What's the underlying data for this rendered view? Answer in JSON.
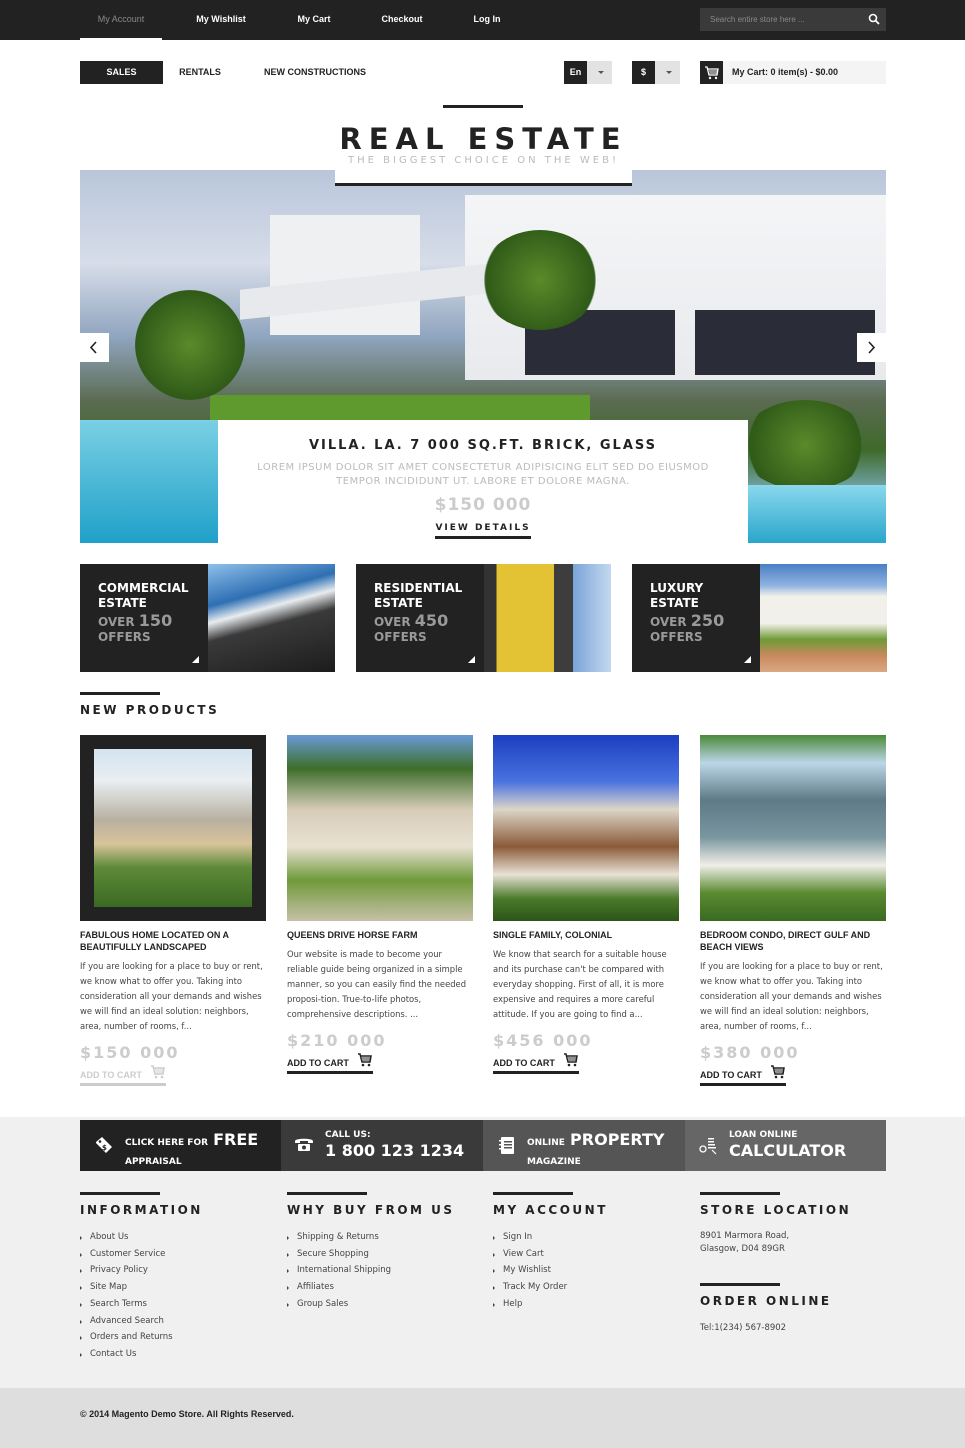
{
  "topbar": {
    "links": [
      "My Account",
      "My Wishlist",
      "My Cart",
      "Checkout",
      "Log In"
    ],
    "active_link": "My Account",
    "search_placeholder": "Search entire store here ..."
  },
  "category_nav": [
    "SALES",
    "RENTALS",
    "NEW CONSTRUCTIONS"
  ],
  "language": {
    "value": "En"
  },
  "currency": {
    "value": "$"
  },
  "cart": {
    "label": "My Cart: 0 item(s) - $0.00"
  },
  "logo": {
    "title": "REAL ESTATE",
    "slogan": "THE BIGGEST CHOICE ON THE WEB!"
  },
  "hero": {
    "title": "VILLA. LA. 7 000 SQ.FT. BRICK, GLASS",
    "description": "LOREM IPSUM DOLOR SIT AMET CONSECTETUR ADIPISICING ELIT SED DO EIUSMOD TEMPOR INCIDIDUNT UT. LABORE ET DOLORE MAGNA.",
    "price": "$150 000",
    "button": "VIEW DETAILS"
  },
  "banners": [
    {
      "line1": "COMMERCIAL",
      "line2": "ESTATE",
      "over": "OVER",
      "count": "150",
      "offers": "OFFERS"
    },
    {
      "line1": "RESIDENTIAL",
      "line2": "ESTATE",
      "over": "OVER",
      "count": "450",
      "offers": "OFFERS"
    },
    {
      "line1": "LUXURY",
      "line2": "ESTATE",
      "over": "OVER",
      "count": "250",
      "offers": "OFFERS"
    }
  ],
  "new_products": {
    "title": "NEW PRODUCTS",
    "items": [
      {
        "name": "FABULOUS HOME LOCATED ON A BEAUTIFULLY LANDSCAPED",
        "description": "If you are looking for a place to buy or rent, we know what to offer you. Taking into consideration all your demands and wishes we will find an ideal solution: neighbors, area, number of rooms, f...",
        "price": "$150 000",
        "add_to_cart": "ADD TO CART"
      },
      {
        "name": "QUEENS DRIVE HORSE FARM",
        "description": "Our website is made to become your reliable guide being organized in a simple manner, so you can easily find the needed proposi-tion. True-to-life photos, comprehensive descriptions. ...",
        "price": "$210 000",
        "add_to_cart": "ADD TO CART"
      },
      {
        "name": "SINGLE FAMILY, COLONIAL",
        "description": "We know that search for a suitable house and its purchase can't be compared with everyday shopping. First of all, it is more expensive and requires a more careful attitude. If you are going to find a...",
        "price": "$456 000",
        "add_to_cart": "ADD TO CART"
      },
      {
        "name": "BEDROOM CONDO, DIRECT GULF AND BEACH VIEWS",
        "description": "If you are looking for a place to buy or rent, we know what to offer you. Taking into consideration all your demands and wishes we will find an ideal solution: neighbors, area, number of rooms, f...",
        "price": "$380 000",
        "add_to_cart": "ADD TO CART"
      }
    ]
  },
  "promo": [
    {
      "small1": "CLICK HERE FOR",
      "big": "FREE",
      "small2": "APPRAISAL",
      "icon": "price-tag-icon",
      "color": "#222222"
    },
    {
      "small1": "CALL US:",
      "big": "1 800 123 1234",
      "icon": "phone-icon",
      "color": "#3a3a3a"
    },
    {
      "small1": "ONLINE",
      "big": "PROPERTY",
      "small2": "MAGAZINE",
      "icon": "notebook-icon",
      "color": "#555555"
    },
    {
      "small1": "LOAN ONLINE",
      "big": "CALCULATOR",
      "icon": "coins-icon",
      "color": "#666666"
    }
  ],
  "footer": {
    "information": {
      "title": "INFORMATION",
      "links": [
        "About Us",
        "Customer Service",
        "Privacy Policy",
        "Site Map",
        "Search Terms",
        "Advanced Search",
        "Orders and Returns",
        "Contact Us"
      ]
    },
    "why_buy": {
      "title": "WHY BUY FROM US",
      "links": [
        "Shipping & Returns",
        "Secure Shopping",
        "International Shipping",
        "Affiliates",
        "Group Sales"
      ]
    },
    "my_account": {
      "title": "MY ACCOUNT",
      "links": [
        "Sign In",
        "View Cart",
        "My Wishlist",
        "Track My Order",
        "Help"
      ]
    },
    "store_location": {
      "title": "STORE LOCATION",
      "address1": "8901 Marmora Road,",
      "address2": "Glasgow, D04 89GR"
    },
    "order_online": {
      "title": "ORDER ONLINE",
      "tel": "Tel:1(234) 567-8902"
    }
  },
  "copyright": "© 2014 Magento Demo Store. All Rights Reserved."
}
